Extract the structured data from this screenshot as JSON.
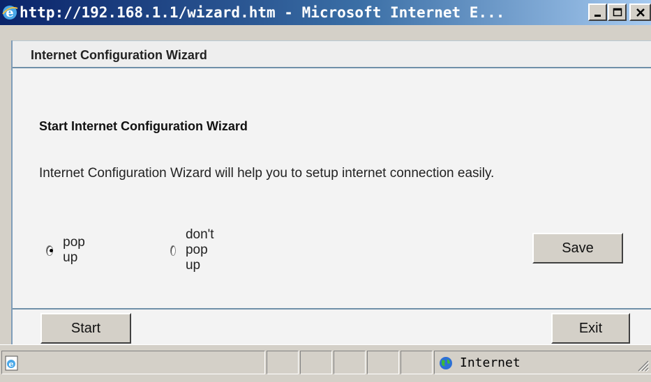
{
  "window": {
    "title": "http://192.168.1.1/wizard.htm - Microsoft Internet E...",
    "controls": [
      "minimize-icon",
      "maximize-icon",
      "close-icon"
    ]
  },
  "wizard": {
    "header_title": "Internet Configuration Wizard",
    "section_title": "Start Internet Configuration Wizard",
    "description": "Internet Configuration Wizard will help you to setup internet connection easily.",
    "radio_options": [
      {
        "label": "pop up",
        "checked": true
      },
      {
        "label": "don't pop up",
        "checked": false
      }
    ],
    "save_label": "Save",
    "start_label": "Start",
    "exit_label": "Exit"
  },
  "statusbar": {
    "page_icon": "ie-page-icon",
    "zone_icon": "globe-icon",
    "zone_label": "Internet"
  },
  "colors": {
    "titlebar_start": "#0a246a",
    "titlebar_end": "#a6caf0",
    "panel_bg": "#f3f3f3",
    "divider": "#6f8fa8",
    "chrome": "#d4d0c8"
  }
}
